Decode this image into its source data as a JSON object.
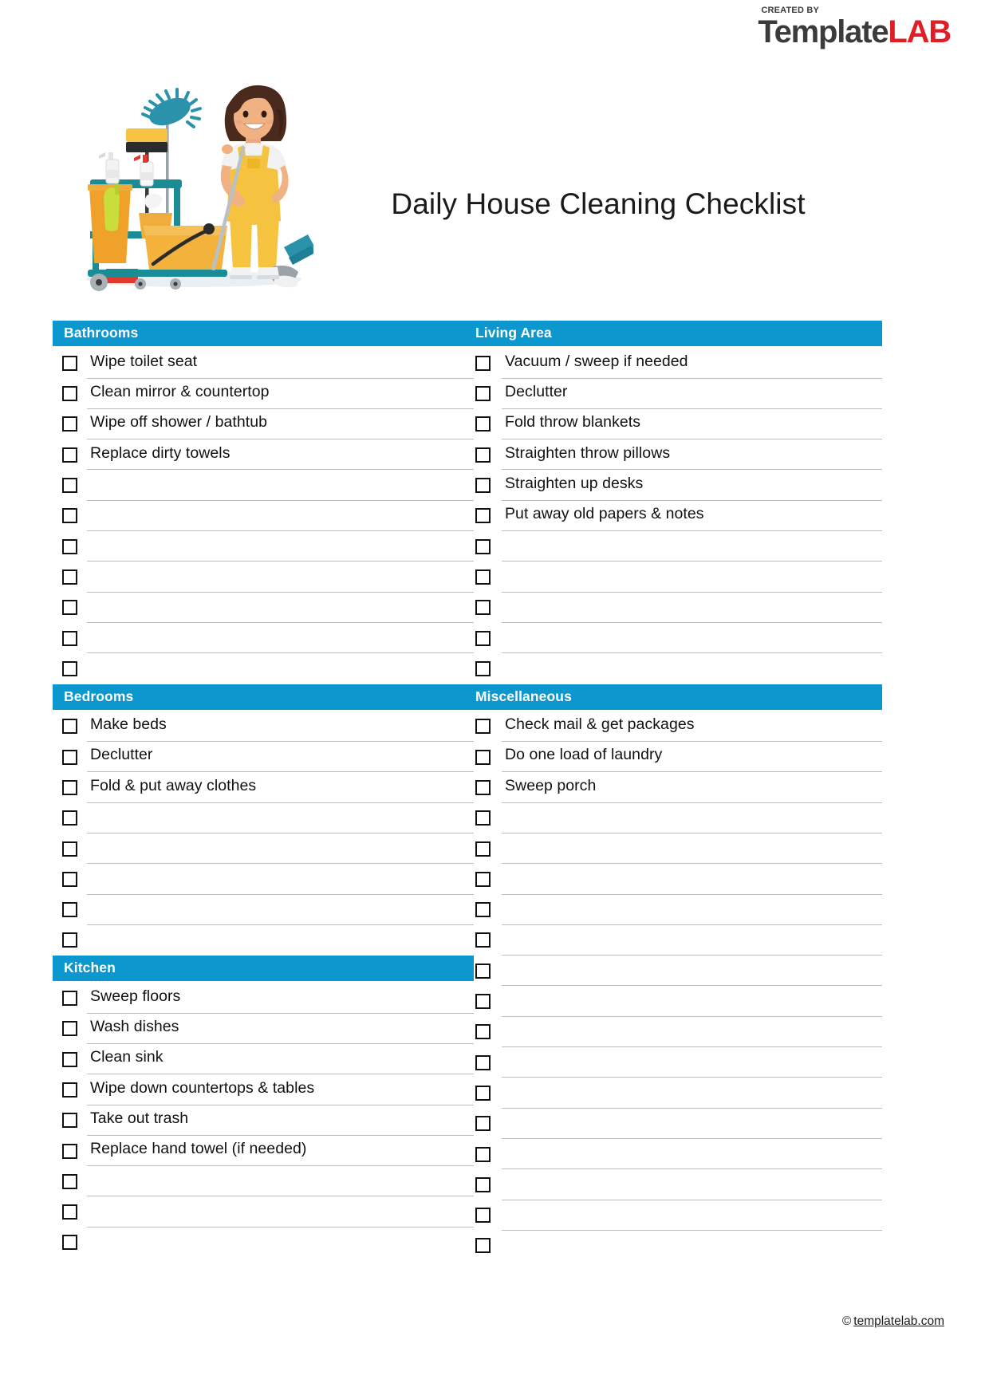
{
  "brand": {
    "created_by": "CREATED BY",
    "name_dark": "Template",
    "name_red": "LAB",
    "flask_icon": "flask-icon",
    "dark_color": "#3b3b3b",
    "red_color": "#e01e26"
  },
  "header": {
    "title": "Daily House Cleaning Checklist",
    "illustration": "cleaning-lady-with-cart-illustration"
  },
  "theme": {
    "header_bar_color": "#0c97ce",
    "rule_color": "#bdbdbd",
    "checkbox_color": "#111111"
  },
  "columns": [
    {
      "id": "left",
      "sections": [
        {
          "title": "Bathrooms",
          "rows": [
            "Wipe toilet seat",
            "Clean mirror & countertop",
            "Wipe off shower / bathtub",
            "Replace dirty towels",
            "",
            "",
            "",
            "",
            "",
            "",
            ""
          ]
        },
        {
          "title": "Bedrooms",
          "rows": [
            "Make beds",
            "Declutter",
            "Fold & put away clothes",
            "",
            "",
            "",
            "",
            ""
          ]
        },
        {
          "title": "Kitchen",
          "rows": [
            "Sweep floors",
            "Wash dishes",
            "Clean sink",
            "Wipe down countertops & tables",
            "Take out trash",
            "Replace hand towel (if needed)",
            "",
            "",
            ""
          ]
        }
      ]
    },
    {
      "id": "right",
      "sections": [
        {
          "title": "Living Area",
          "rows": [
            "Vacuum / sweep if needed",
            "Declutter",
            "Fold throw blankets",
            "Straighten throw pillows",
            "Straighten up desks",
            "Put away old papers & notes",
            "",
            "",
            "",
            "",
            ""
          ]
        },
        {
          "title": "Miscellaneous",
          "rows": [
            "Check mail & get packages",
            "Do one load of laundry",
            "Sweep porch",
            "",
            "",
            "",
            "",
            "",
            "",
            "",
            "",
            "",
            "",
            "",
            "",
            "",
            "",
            ""
          ]
        }
      ]
    }
  ],
  "footer": {
    "copyright_symbol": "©",
    "site": "templatelab.com"
  }
}
